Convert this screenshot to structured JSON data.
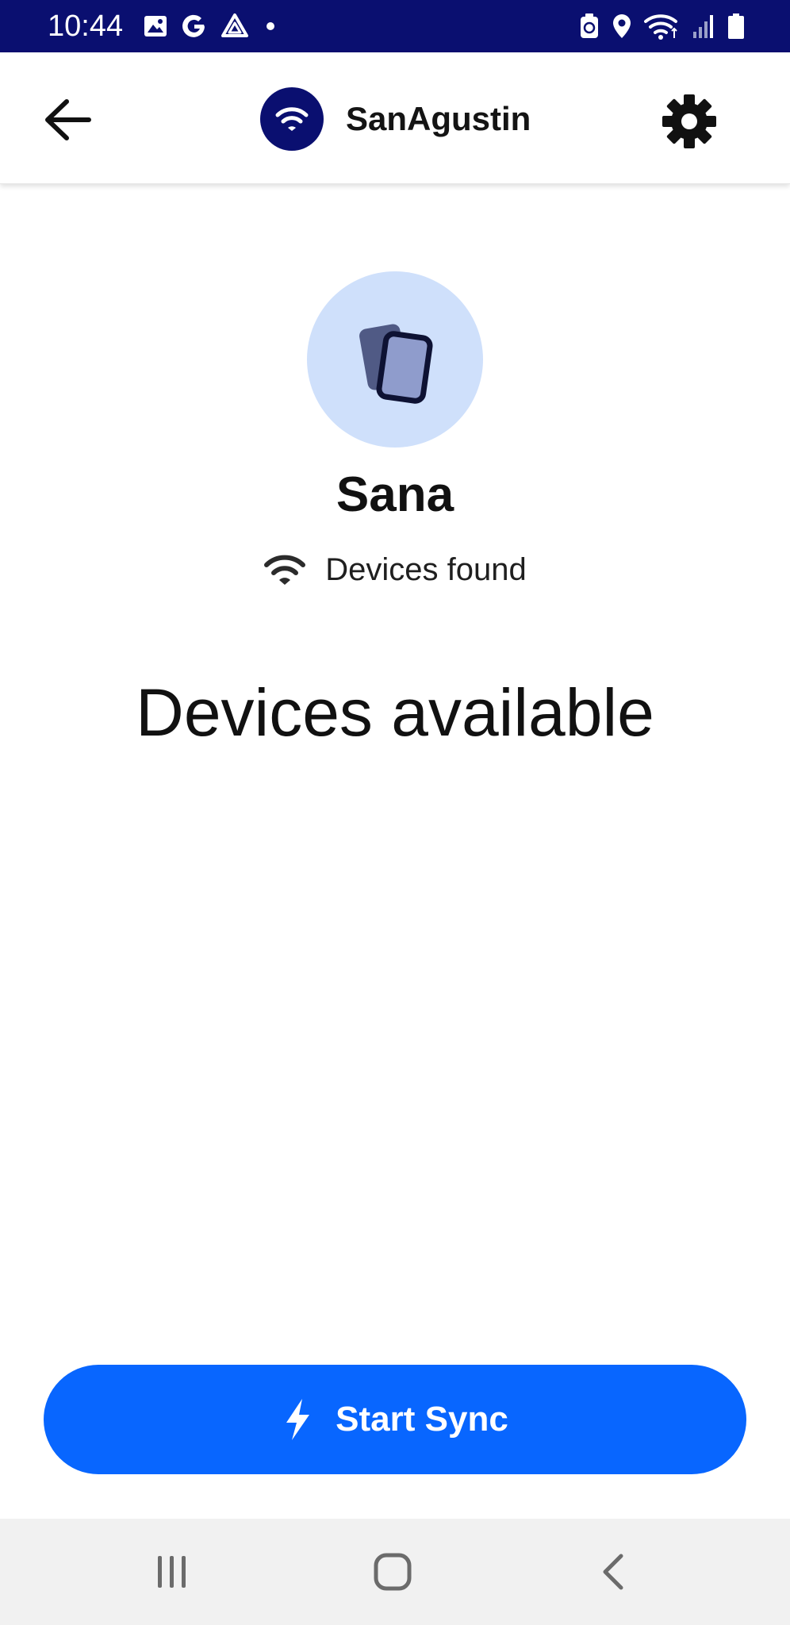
{
  "status_bar": {
    "time": "10:44",
    "background": "#0a0f70",
    "left_icons": [
      "gallery-icon",
      "google-icon",
      "drive-icon",
      "dot-icon"
    ],
    "right_icons": [
      "battery-saver-icon",
      "location-icon",
      "wifi-icon",
      "signal-icon",
      "battery-icon"
    ]
  },
  "app_bar": {
    "network_name": "SanAgustin",
    "back_icon": "arrow-left-icon",
    "network_icon": "wifi-icon",
    "settings_icon": "gear-icon"
  },
  "device": {
    "name": "Sana",
    "status_text": "Devices found",
    "avatar_icon": "devices-icon",
    "avatar_bg": "#cfe0fb"
  },
  "main": {
    "heading": "Devices available"
  },
  "actions": {
    "start_sync_label": "Start Sync",
    "start_sync_icon": "lightning-icon",
    "accent": "#0866ff"
  },
  "nav_bar": {
    "buttons": [
      "recents-icon",
      "home-icon",
      "back-icon"
    ]
  }
}
